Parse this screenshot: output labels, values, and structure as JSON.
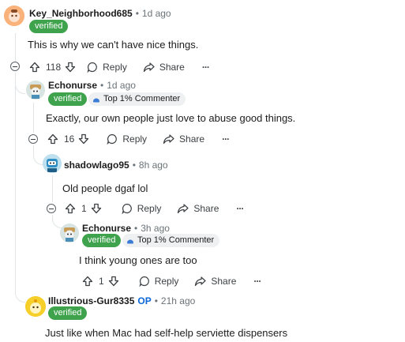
{
  "comments": [
    {
      "username": "Key_Neighborhood685",
      "time": "1d ago",
      "flair": "verified",
      "text": "This is why we can't have nice things.",
      "votes": "118",
      "reply_label": "Reply",
      "share_label": "Share",
      "more_label": "···"
    },
    {
      "username": "Echonurse",
      "time": "1d ago",
      "flair": "verified",
      "top_badge": "Top 1% Commenter",
      "text": "Exactly, our own people just love to abuse good things.",
      "votes": "16",
      "reply_label": "Reply",
      "share_label": "Share",
      "more_label": "···"
    },
    {
      "username": "shadowlago95",
      "time": "8h ago",
      "text": "Old people dgaf lol",
      "votes": "1",
      "reply_label": "Reply",
      "share_label": "Share",
      "more_label": "···"
    },
    {
      "username": "Echonurse",
      "time": "3h ago",
      "flair": "verified",
      "top_badge": "Top 1% Commenter",
      "text": "I think young ones are too",
      "votes": "1",
      "reply_label": "Reply",
      "share_label": "Share",
      "more_label": "···"
    },
    {
      "username": "Illustrious-Gur8335",
      "op_label": "OP",
      "time": "21h ago",
      "flair": "verified",
      "text": "Just like when Mac had self-help serviette dispensers"
    }
  ],
  "colors": {
    "verified_bg": "#3fa34d",
    "op_color": "#0a66d8",
    "thread_line": "#e2e5e7",
    "meta_gray": "#6b7378"
  },
  "separator": "•"
}
